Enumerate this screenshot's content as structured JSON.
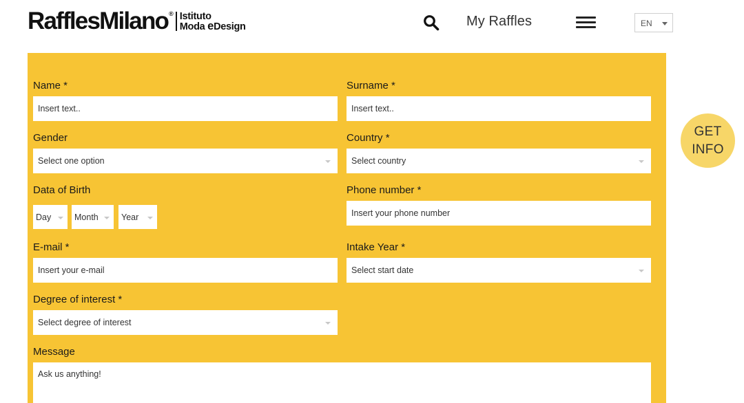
{
  "header": {
    "logo_main": "RafflesMilano",
    "logo_registered": "®",
    "logo_sub_line1": "Istituto",
    "logo_sub_line2_a": "Moda ",
    "logo_sub_line2_b": "e",
    "logo_sub_line2_c": "Design",
    "search_icon": "search-icon",
    "my_raffles_label": "My Raffles",
    "menu_icon": "hamburger-menu-icon",
    "language": {
      "selected": "EN"
    }
  },
  "form": {
    "name": {
      "label": "Name *",
      "placeholder": "Insert text.."
    },
    "surname": {
      "label": "Surname *",
      "placeholder": "Insert text.."
    },
    "gender": {
      "label": "Gender",
      "placeholder": "Select one option"
    },
    "country": {
      "label": "Country *",
      "placeholder": "Select country"
    },
    "birth": {
      "label": "Data of Birth",
      "day": "Day",
      "month": "Month",
      "year": "Year"
    },
    "phone": {
      "label": "Phone number *",
      "placeholder": "Insert your phone number"
    },
    "email": {
      "label": "E-mail *",
      "placeholder": "Insert your e-mail"
    },
    "intake": {
      "label": "Intake Year *",
      "placeholder": "Select start date"
    },
    "degree": {
      "label": "Degree of interest *",
      "placeholder": "Select degree of interest"
    },
    "message": {
      "label": "Message",
      "placeholder": "Ask us anything!"
    }
  },
  "get_info": {
    "line1": "GET",
    "line2": "INFO"
  },
  "colors": {
    "form_background": "#f7c434",
    "get_info_background": "#f7d668"
  }
}
